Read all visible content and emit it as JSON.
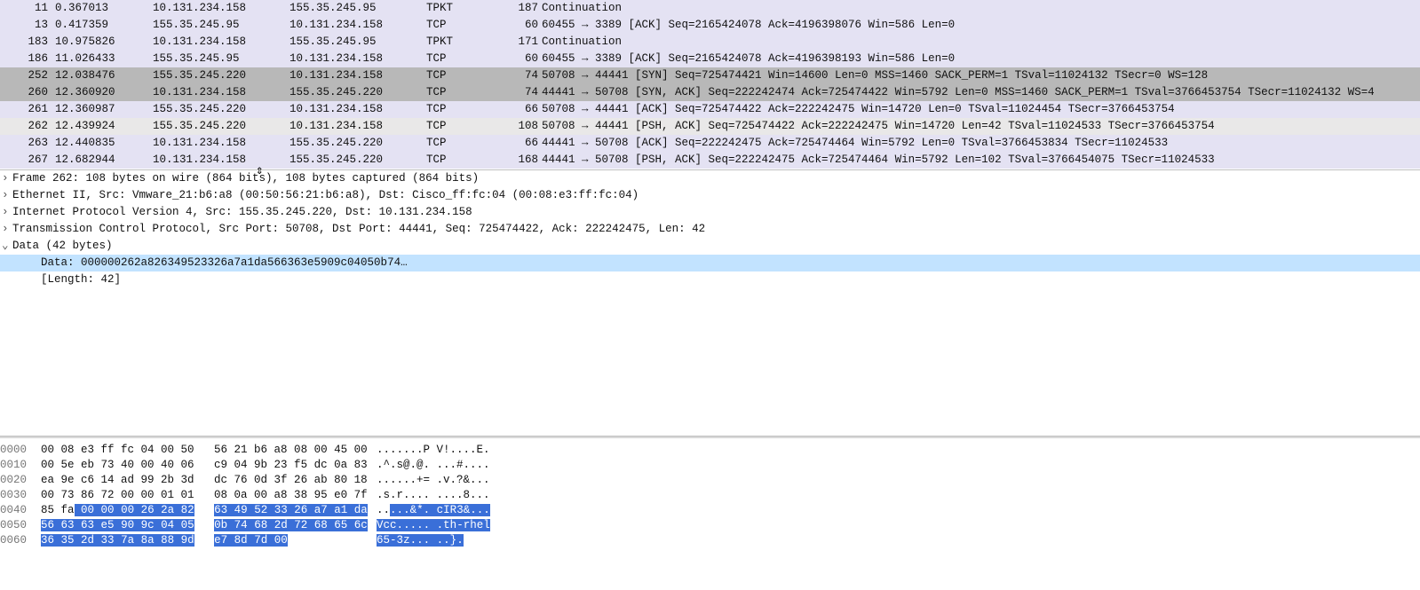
{
  "packet_list": {
    "rows": [
      {
        "no": "11",
        "time": "0.367013",
        "src": "10.131.234.158",
        "dst": "155.35.245.95",
        "proto": "TPKT",
        "len": "187",
        "info": "Continuation",
        "color": "lavender"
      },
      {
        "no": "13",
        "time": "0.417359",
        "src": "155.35.245.95",
        "dst": "10.131.234.158",
        "proto": "TCP",
        "len": "60",
        "info": "60455 → 3389 [ACK] Seq=2165424078 Ack=4196398076 Win=586 Len=0",
        "color": "lavender"
      },
      {
        "no": "183",
        "time": "10.975826",
        "src": "10.131.234.158",
        "dst": "155.35.245.95",
        "proto": "TPKT",
        "len": "171",
        "info": "Continuation",
        "color": "lavender"
      },
      {
        "no": "186",
        "time": "11.026433",
        "src": "155.35.245.95",
        "dst": "10.131.234.158",
        "proto": "TCP",
        "len": "60",
        "info": "60455 → 3389 [ACK] Seq=2165424078 Ack=4196398193 Win=586 Len=0",
        "color": "lavender"
      },
      {
        "no": "252",
        "time": "12.038476",
        "src": "155.35.245.220",
        "dst": "10.131.234.158",
        "proto": "TCP",
        "len": "74",
        "info": "50708 → 44441 [SYN] Seq=725474421 Win=14600 Len=0 MSS=1460 SACK_PERM=1 TSval=11024132 TSecr=0 WS=128",
        "color": "gray"
      },
      {
        "no": "260",
        "time": "12.360920",
        "src": "10.131.234.158",
        "dst": "155.35.245.220",
        "proto": "TCP",
        "len": "74",
        "info": "44441 → 50708 [SYN, ACK] Seq=222242474 Ack=725474422 Win=5792 Len=0 MSS=1460 SACK_PERM=1 TSval=3766453754 TSecr=11024132 WS=4",
        "color": "gray"
      },
      {
        "no": "261",
        "time": "12.360987",
        "src": "155.35.245.220",
        "dst": "10.131.234.158",
        "proto": "TCP",
        "len": "66",
        "info": "50708 → 44441 [ACK] Seq=725474422 Ack=222242475 Win=14720 Len=0 TSval=11024454 TSecr=3766453754",
        "color": "lavender"
      },
      {
        "no": "262",
        "time": "12.439924",
        "src": "155.35.245.220",
        "dst": "10.131.234.158",
        "proto": "TCP",
        "len": "108",
        "info": "50708 → 44441 [PSH, ACK] Seq=725474422 Ack=222242475 Win=14720 Len=42 TSval=11024533 TSecr=3766453754",
        "color": "selected"
      },
      {
        "no": "263",
        "time": "12.440835",
        "src": "10.131.234.158",
        "dst": "155.35.245.220",
        "proto": "TCP",
        "len": "66",
        "info": "44441 → 50708 [ACK] Seq=222242475 Ack=725474464 Win=5792 Len=0 TSval=3766453834 TSecr=11024533",
        "color": "lavender"
      },
      {
        "no": "267",
        "time": "12.682944",
        "src": "10.131.234.158",
        "dst": "155.35.245.220",
        "proto": "TCP",
        "len": "168",
        "info": "44441 → 50708 [PSH, ACK] Seq=222242475 Ack=725474464 Win=5792 Len=102 TSval=3766454075 TSecr=11024533",
        "color": "lavender"
      }
    ]
  },
  "packet_details": {
    "lines": [
      {
        "expand": "right",
        "indent": 0,
        "text": "Frame 262: 108 bytes on wire (864 bits), 108 bytes captured (864 bits)",
        "sel": false
      },
      {
        "expand": "right",
        "indent": 0,
        "text": "Ethernet II, Src: Vmware_21:b6:a8 (00:50:56:21:b6:a8), Dst: Cisco_ff:fc:04 (00:08:e3:ff:fc:04)",
        "sel": false
      },
      {
        "expand": "right",
        "indent": 0,
        "text": "Internet Protocol Version 4, Src: 155.35.245.220, Dst: 10.131.234.158",
        "sel": false
      },
      {
        "expand": "right",
        "indent": 0,
        "text": "Transmission Control Protocol, Src Port: 50708, Dst Port: 44441, Seq: 725474422, Ack: 222242475, Len: 42",
        "sel": false
      },
      {
        "expand": "down",
        "indent": 0,
        "text": "Data (42 bytes)",
        "sel": false
      },
      {
        "expand": "",
        "indent": 1,
        "text": "Data: 000000262a826349523326a7a1da566363e5909c04050b74…",
        "sel": true
      },
      {
        "expand": "",
        "indent": 1,
        "text": "[Length: 42]",
        "sel": false
      }
    ]
  },
  "hex_dump": {
    "rows": [
      {
        "offset": "0000",
        "bytes1": "00 08 e3 ff fc 04 00 50",
        "bytes2": "56 21 b6 a8 08 00 45 00",
        "ascii": ".......P V!....E.",
        "sel1": [],
        "sel2": []
      },
      {
        "offset": "0010",
        "bytes1": "00 5e eb 73 40 00 40 06",
        "bytes2": "c9 04 9b 23 f5 dc 0a 83",
        "ascii": ".^.s@.@. ...#....",
        "sel1": [],
        "sel2": []
      },
      {
        "offset": "0020",
        "bytes1": "ea 9e c6 14 ad 99 2b 3d",
        "bytes2": "dc 76 0d 3f 26 ab 80 18",
        "ascii": "......+= .v.?&...",
        "sel1": [],
        "sel2": []
      },
      {
        "offset": "0030",
        "bytes1": "00 73 86 72 00 00 01 01",
        "bytes2": "08 0a 00 a8 38 95 e0 7f",
        "ascii": ".s.r.... ....8...",
        "sel1": [],
        "sel2": []
      },
      {
        "offset": "0040",
        "bytes1": "85 fa 00 00 00 26 2a 82",
        "bytes2": "63 49 52 33 26 a7 a1 da",
        "ascii": ".....&*. cIR3&...",
        "sel1": [
          2,
          8
        ],
        "sel2": [
          0,
          8
        ],
        "asciiSel": [
          2,
          17
        ]
      },
      {
        "offset": "0050",
        "bytes1": "56 63 63 e5 90 9c 04 05",
        "bytes2": "0b 74 68 2d 72 68 65 6c",
        "ascii": "Vcc..... .th-rhel",
        "sel1": [
          0,
          8
        ],
        "sel2": [
          0,
          8
        ],
        "asciiSel": [
          0,
          17
        ]
      },
      {
        "offset": "0060",
        "bytes1": "36 35 2d 33 7a 8a 88 9d",
        "bytes2": "e7 8d 7d 00",
        "ascii": "65-3z... ..}.",
        "sel1": [
          0,
          8
        ],
        "sel2": [
          0,
          4
        ],
        "asciiSel": [
          0,
          13
        ]
      }
    ]
  }
}
